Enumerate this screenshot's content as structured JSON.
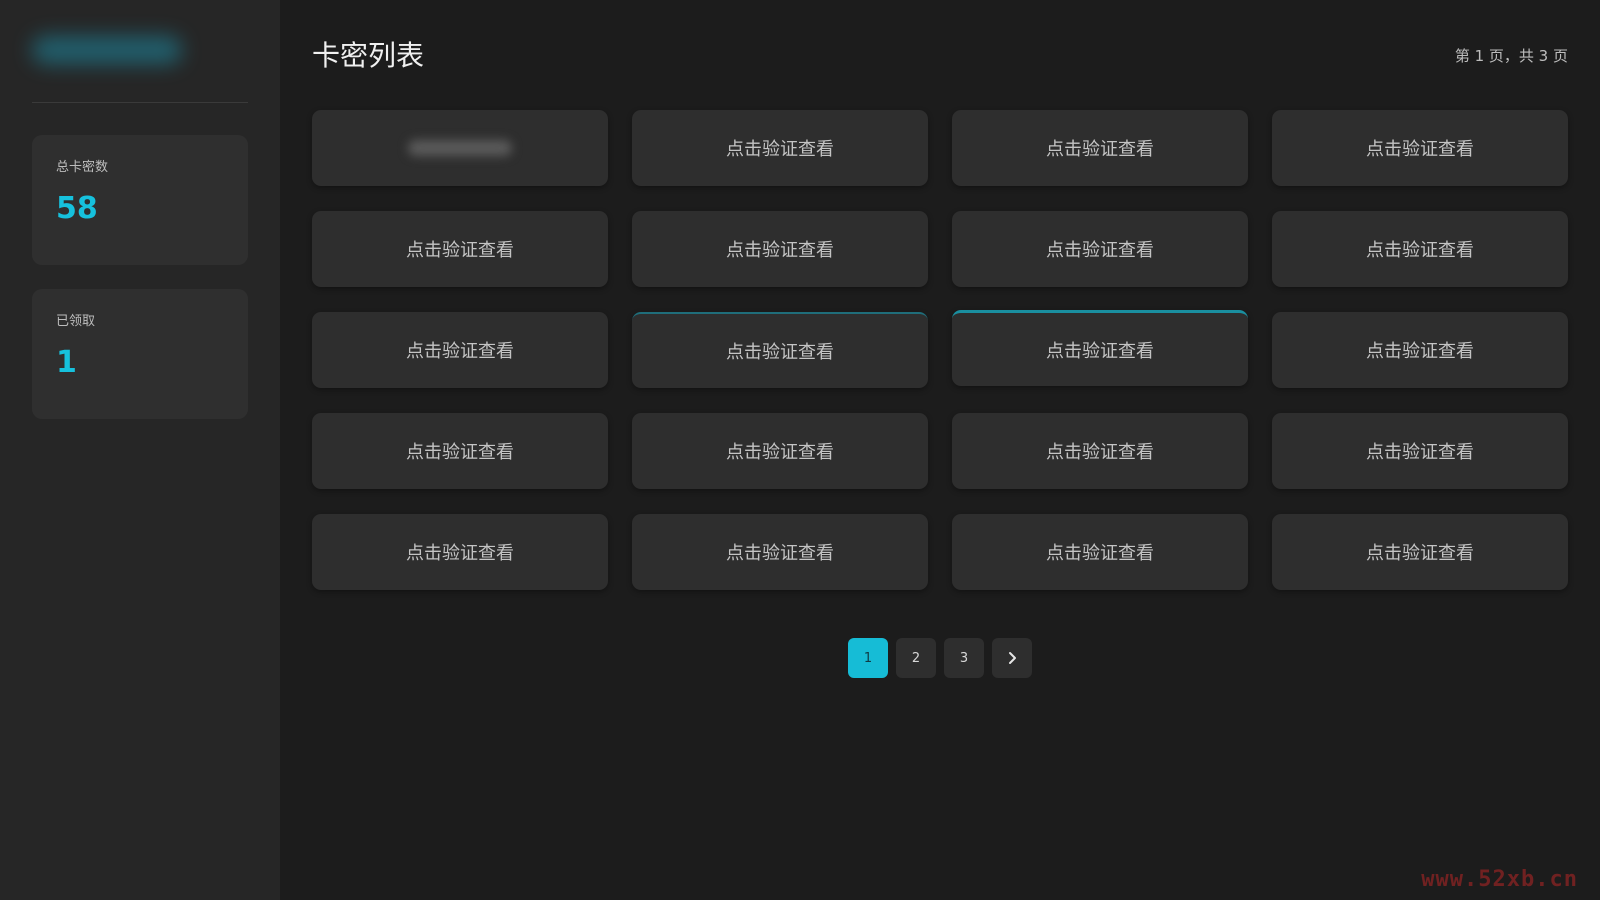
{
  "sidebar": {
    "stats": [
      {
        "label": "总卡密数",
        "value": "58"
      },
      {
        "label": "已领取",
        "value": "1"
      }
    ]
  },
  "header": {
    "title": "卡密列表",
    "page_info": "第 1 页，共 3 页"
  },
  "cards": [
    "",
    "点击验证查看",
    "点击验证查看",
    "点击验证查看",
    "点击验证查看",
    "点击验证查看",
    "点击验证查看",
    "点击验证查看",
    "点击验证查看",
    "点击验证查看",
    "点击验证查看",
    "点击验证查看",
    "点击验证查看",
    "点击验证查看",
    "点击验证查看",
    "点击验证查看",
    "点击验证查看",
    "点击验证查看",
    "点击验证查看",
    "点击验证查看"
  ],
  "pagination": {
    "pages": [
      "1",
      "2",
      "3"
    ],
    "current": "1",
    "next_icon": "chevron-right-icon"
  },
  "watermark": "www.52xb.cn",
  "colors": {
    "accent": "#16bcd6",
    "background": "#1c1c1c",
    "sidebar": "#262626",
    "card": "#2e2e2e"
  }
}
